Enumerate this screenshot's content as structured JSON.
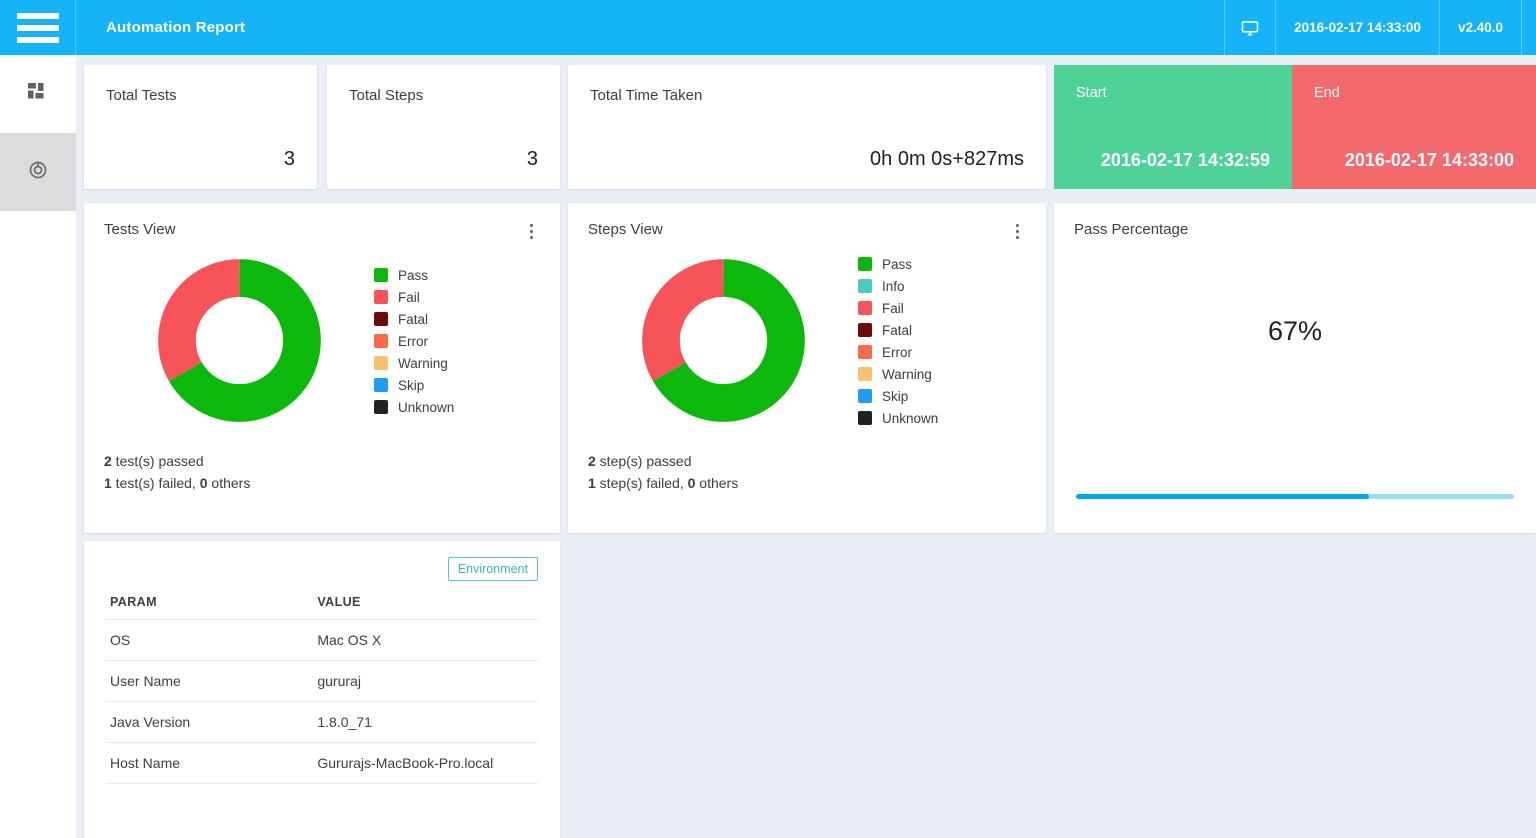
{
  "topbar": {
    "menu_icon": "hamburger-menu-icon",
    "title": "Automation Report",
    "monitor_icon": "monitor-icon",
    "timestamp": "2016-02-17 14:33:00",
    "version": "v2.40.0",
    "background_color": "#15b4f7"
  },
  "sidebar": {
    "items": [
      {
        "icon": "dashboard-grid-icon",
        "active": false
      },
      {
        "icon": "donut-chart-icon",
        "active": true
      }
    ]
  },
  "kpis": [
    {
      "label": "Total Tests",
      "value": "3"
    },
    {
      "label": "Total Steps",
      "value": "3"
    },
    {
      "label": "Total Time Taken",
      "value": "0h 0m 0s+827ms"
    }
  ],
  "timecards": [
    {
      "label": "Start",
      "value": "2016-02-17 14:32:59",
      "color": "#4fd297"
    },
    {
      "label": "End",
      "value": "2016-02-17 14:33:00",
      "color": "#f4696b"
    }
  ],
  "tests_view": {
    "title": "Tests View",
    "menu_icon": "kebab-menu-icon",
    "summary_passed_count": "2",
    "summary_passed_text": " test(s) passed",
    "summary_failed_count": "1",
    "summary_failed_text": " test(s) failed, ",
    "summary_others_count": "0",
    "summary_others_text": " others"
  },
  "steps_view": {
    "title": "Steps View",
    "menu_icon": "kebab-menu-icon",
    "summary_passed_count": "2",
    "summary_passed_text": " step(s) passed",
    "summary_failed_count": "1",
    "summary_failed_text": " step(s) failed, ",
    "summary_others_count": "0",
    "summary_others_text": " others"
  },
  "pass_percentage": {
    "title": "Pass Percentage",
    "value_label": "67%",
    "value": 67,
    "bar_fill_color": "#00a6f0",
    "bar_track_color": "#9ddcf7"
  },
  "environment": {
    "badge": "Environment",
    "columns": [
      "PARAM",
      "VALUE"
    ],
    "rows": [
      {
        "param": "OS",
        "value": "Mac OS X"
      },
      {
        "param": "User Name",
        "value": "gururaj"
      },
      {
        "param": "Java Version",
        "value": "1.8.0_71"
      },
      {
        "param": "Host Name",
        "value": "Gururajs-MacBook-Pro.local"
      }
    ]
  },
  "chart_data": [
    {
      "type": "pie",
      "title": "Tests View",
      "variant": "donut",
      "legend_position": "right",
      "labels": [
        "Pass",
        "Fail",
        "Fatal",
        "Error",
        "Warning",
        "Skip",
        "Unknown"
      ],
      "values": [
        2,
        1,
        0,
        0,
        0,
        0,
        0
      ],
      "colors": [
        "#0cb80c",
        "#f7545a",
        "#6d0a0a",
        "#fa6a4a",
        "#fcbf6e",
        "#1e9bf5",
        "#222222"
      ]
    },
    {
      "type": "pie",
      "title": "Steps View",
      "variant": "donut",
      "legend_position": "right",
      "labels": [
        "Pass",
        "Info",
        "Fail",
        "Fatal",
        "Error",
        "Warning",
        "Skip",
        "Unknown"
      ],
      "values": [
        2,
        0,
        1,
        0,
        0,
        0,
        0,
        0
      ],
      "colors": [
        "#0cb80c",
        "#4fc9c4",
        "#f7545a",
        "#6d0a0a",
        "#fa6a4a",
        "#fcbf6e",
        "#1e9bf5",
        "#222222"
      ]
    },
    {
      "type": "bar",
      "title": "Pass Percentage",
      "categories": [
        "Pass Percentage"
      ],
      "values": [
        67
      ],
      "ylim": [
        0,
        100
      ],
      "ylabel": "%"
    }
  ]
}
